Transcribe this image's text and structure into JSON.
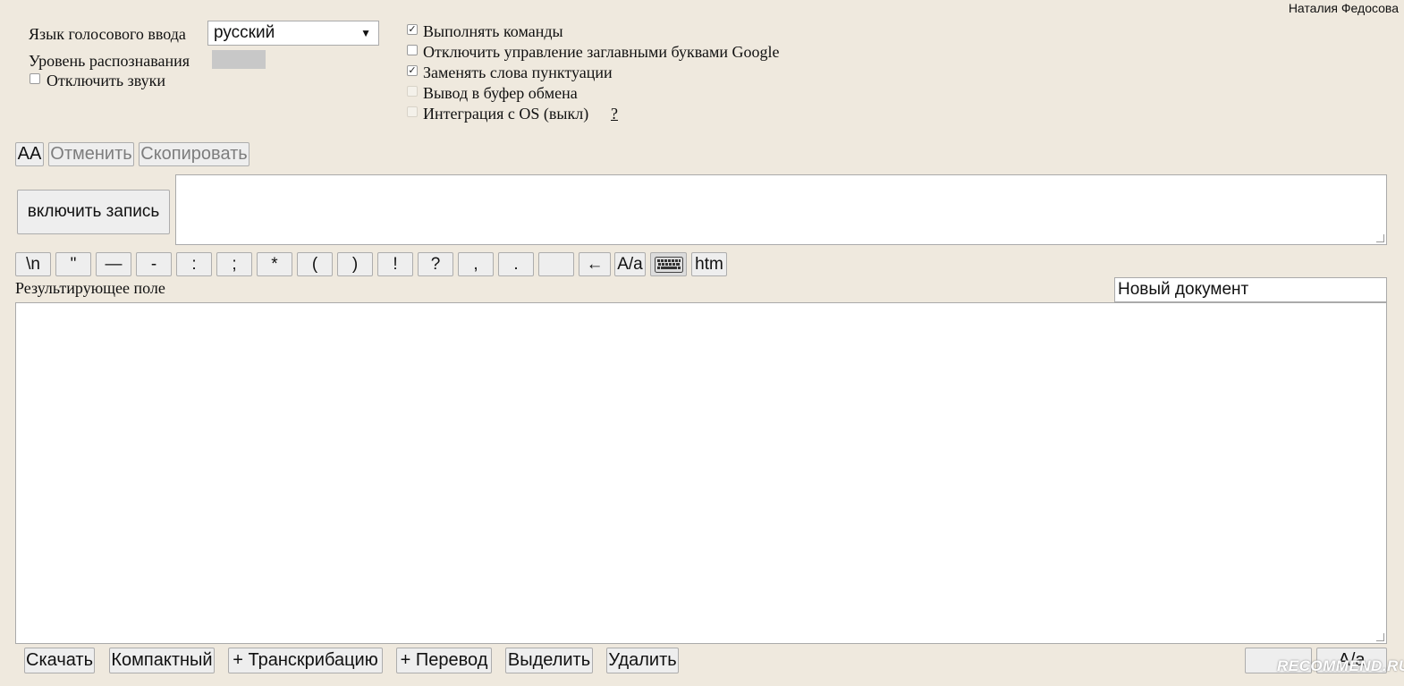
{
  "header": {
    "user_name": "Наталия Федосова"
  },
  "settings": {
    "language_label": "Язык голосового ввода",
    "language_value": "русский",
    "recognition_label": "Уровень распознавания",
    "mute_label": "Отключить звуки",
    "options": [
      {
        "label": "Выполнять команды",
        "checked": true,
        "disabled": false
      },
      {
        "label": "Отключить управление заглавными буквами Google",
        "checked": false,
        "disabled": false
      },
      {
        "label": "Заменять слова пунктуации",
        "checked": true,
        "disabled": false
      },
      {
        "label": "Вывод в буфер обмена",
        "checked": false,
        "disabled": true
      },
      {
        "label": "Интеграция с OS (выкл)",
        "checked": false,
        "disabled": true
      }
    ],
    "os_help": "?"
  },
  "toolbar": {
    "aa": "AA",
    "undo": "Отменить",
    "copy": "Скопировать"
  },
  "record_button": "включить запись",
  "symbols": [
    "\\n",
    "\"",
    "—",
    "-",
    ":",
    ";",
    "*",
    "(",
    ")",
    "!",
    "?",
    ",",
    ".",
    "",
    "←",
    "A/a",
    "keyboard-icon",
    "htm"
  ],
  "result": {
    "label": "Результирующее поле",
    "doc_name": "Новый документ"
  },
  "bottom": {
    "download": "Скачать",
    "compact": "Компактный",
    "transcription": "+ Транскрибацию",
    "translate": "+ Перевод",
    "select": "Выделить",
    "delete": "Удалить",
    "case": "A/a"
  },
  "watermark": "RECOMMEND.RU"
}
